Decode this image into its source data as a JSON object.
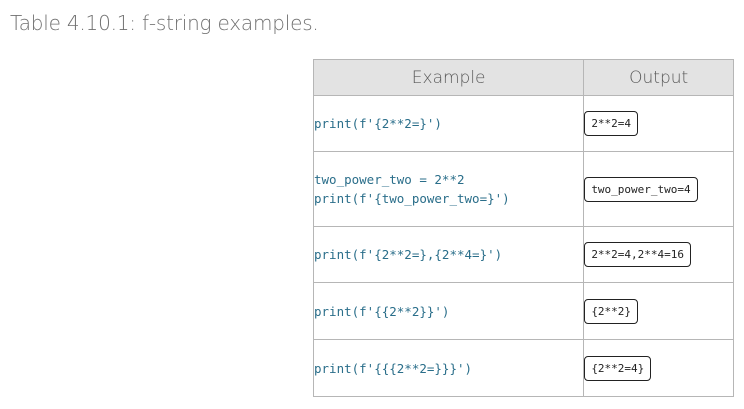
{
  "caption": "Table 4.10.1: f-string examples.",
  "table": {
    "headers": {
      "example": "Example",
      "output": "Output"
    },
    "rows": [
      {
        "example": [
          "print(f'{2**2=}')"
        ],
        "output": "2**2=4"
      },
      {
        "example": [
          "two_power_two = 2**2",
          "print(f'{two_power_two=}')"
        ],
        "output": "two_power_two=4"
      },
      {
        "example": [
          "print(f'{2**2=},{2**4=}')"
        ],
        "output": "2**2=4,2**4=16"
      },
      {
        "example": [
          "print(f'{{2**2}}')"
        ],
        "output": "{2**2}"
      },
      {
        "example": [
          "print(f'{{{2**2=}}}')"
        ],
        "output": "{2**2=4}"
      }
    ]
  },
  "colors": {
    "code": "#2a6e8a",
    "header_bg": "#e3e3e3",
    "border": "#b6b6b6",
    "caption": "#707070"
  }
}
